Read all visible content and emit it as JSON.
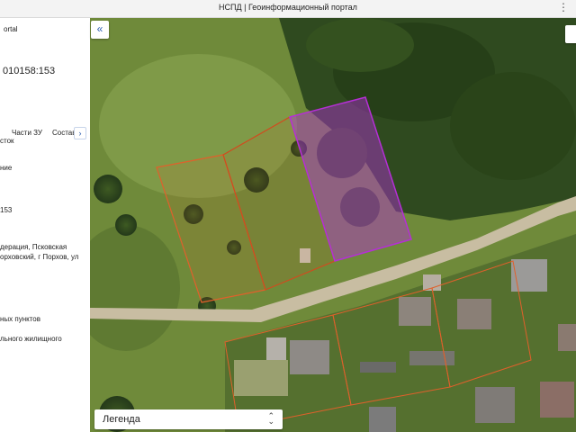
{
  "window": {
    "title": "НСПД | Геоинформационный портал",
    "menu_icon": "more-vert-icon"
  },
  "sidebar": {
    "heading_partial": "ortal",
    "cadastral_number_partial": "010158:153",
    "tabs": {
      "parts": "Части ЗУ",
      "composition": "Состав",
      "next_icon": "chevron-right-icon"
    },
    "lines": [
      "сток",
      "ние",
      "153",
      "дерация, Псковская",
      "орховский, г Порхов, ул",
      "ных пунктов",
      "льного жилищного"
    ]
  },
  "map": {
    "collapse_icon": "double-chevron-left-icon",
    "legend": {
      "label": "Легенда",
      "icon": "chevron-up-down-icon"
    },
    "parcel_colors": {
      "selected": "#b52fd6",
      "neighbor": "#d24a1e",
      "other": "#e0602b"
    }
  }
}
